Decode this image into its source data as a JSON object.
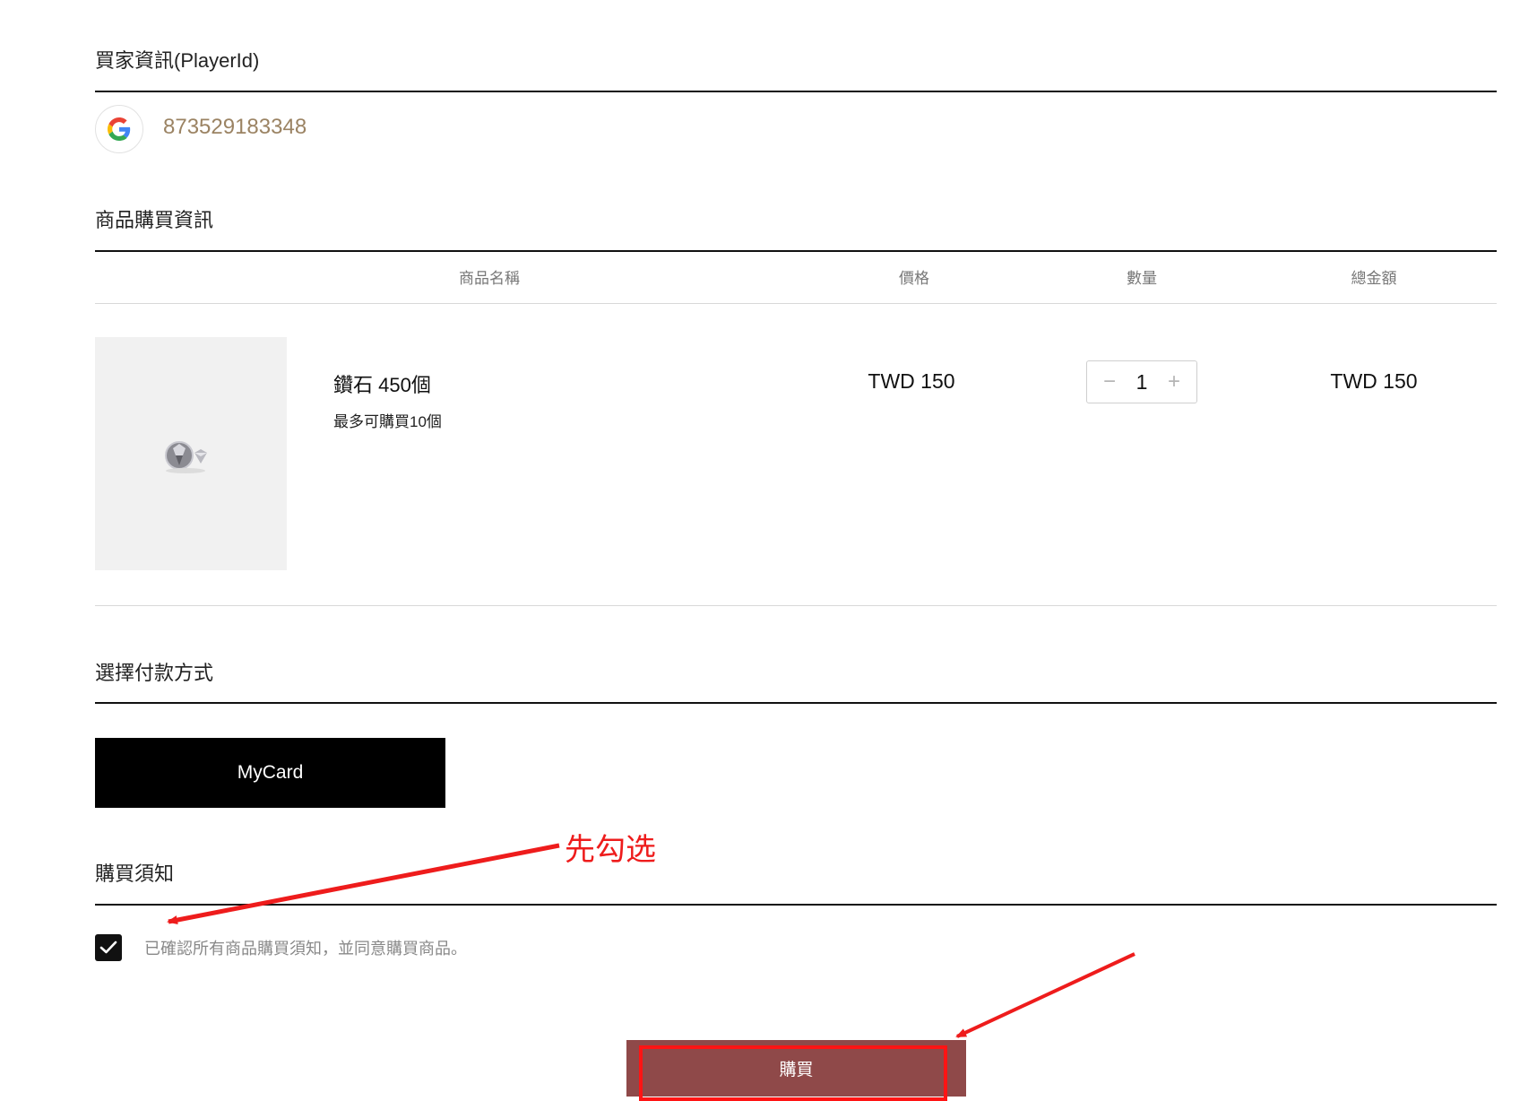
{
  "buyer": {
    "title": "買家資訊(PlayerId)",
    "account_icon": "google-icon",
    "player_id": "873529183348"
  },
  "purchase": {
    "title": "商品購買資訊",
    "columns": [
      "商品名稱",
      "價格",
      "數量",
      "總金額"
    ],
    "item": {
      "image": "diamond-icon",
      "name": "鑽石 450個",
      "limit_note": "最多可購買10個",
      "price": "TWD 150",
      "quantity": "1",
      "total": "TWD 150",
      "minus": "−",
      "plus": "+"
    }
  },
  "payment": {
    "title": "選擇付款方式",
    "options": [
      "MyCard"
    ]
  },
  "notice": {
    "title": "購買須知",
    "agree_label": "已確認所有商品購買須知，並同意購買商品。",
    "checked": true
  },
  "buy_button": "購買",
  "annotation": {
    "text": "先勾选",
    "color": "#ee1c1c"
  }
}
